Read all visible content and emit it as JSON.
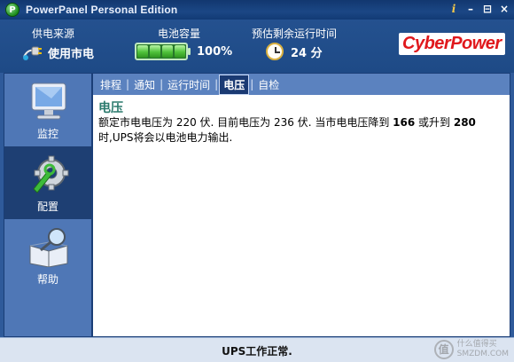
{
  "window": {
    "title": "PowerPanel Personal Edition",
    "app_icon_letter": "P"
  },
  "title_buttons": {
    "info": "i",
    "minimize": "–",
    "restore": "⊟",
    "close": "×"
  },
  "header": {
    "power_source": {
      "label": "供电来源",
      "value": "使用市电",
      "icon": "plug-icon"
    },
    "battery": {
      "label": "电池容量",
      "value": "100%",
      "level": 1.0,
      "cells": 4
    },
    "runtime": {
      "label": "预估剩余运行时间",
      "value": "24 分",
      "icon": "clock-icon"
    },
    "brand": "CyberPower"
  },
  "sidebar": {
    "items": [
      {
        "label": "监控",
        "icon": "monitor-icon",
        "active": false
      },
      {
        "label": "配置",
        "icon": "wrench-gear-icon",
        "active": true
      },
      {
        "label": "帮助",
        "icon": "book-magnifier-icon",
        "active": false
      }
    ]
  },
  "tabs": [
    {
      "label": "排程",
      "active": false
    },
    {
      "label": "通知",
      "active": false
    },
    {
      "label": "运行时间",
      "active": false
    },
    {
      "label": "电压",
      "active": true
    },
    {
      "label": "自检",
      "active": false
    }
  ],
  "tab_separator": "|",
  "section": {
    "title": "电压",
    "line1_a": "额定市电电压为 220 伏. 目前电压为 236 伏. 当市电电压降到 ",
    "low_voltage": "166",
    "line1_b": " 或升到 ",
    "high_voltage": "280",
    "line2": "时,UPS将会以电池电力输出."
  },
  "status": {
    "text": "UPS工作正常.",
    "watermark_symbol": "值",
    "watermark_line1": "什么值得买",
    "watermark_line2": "SMZDM.COM"
  },
  "colors": {
    "brand_red": "#e0181c",
    "battery_green": "#4fc23a",
    "title_teal": "#2b7a6d",
    "nav_active": "#1e3f73"
  }
}
